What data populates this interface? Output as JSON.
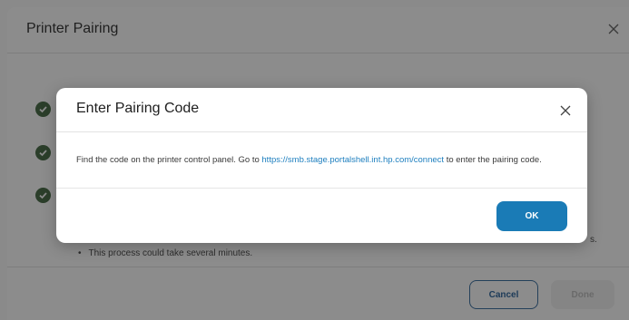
{
  "background_dialog": {
    "title": "Printer Pairing",
    "note": "This process could take several minutes.",
    "bullet": "•",
    "trailing_text": "s.",
    "cancel_label": "Cancel",
    "done_label": "Done"
  },
  "modal": {
    "title": "Enter Pairing Code",
    "text_before": "Find the code on the printer control panel. Go to ",
    "link": "https://smb.stage.portalshell.int.hp.com/connect",
    "text_after": " to enter the pairing code.",
    "ok_label": "OK"
  },
  "icons": {
    "close": "close-icon",
    "check": "check-circle-icon"
  },
  "colors": {
    "accent": "#1a7bb6",
    "link": "#1e7fbf",
    "check": "#2b3e2a"
  }
}
